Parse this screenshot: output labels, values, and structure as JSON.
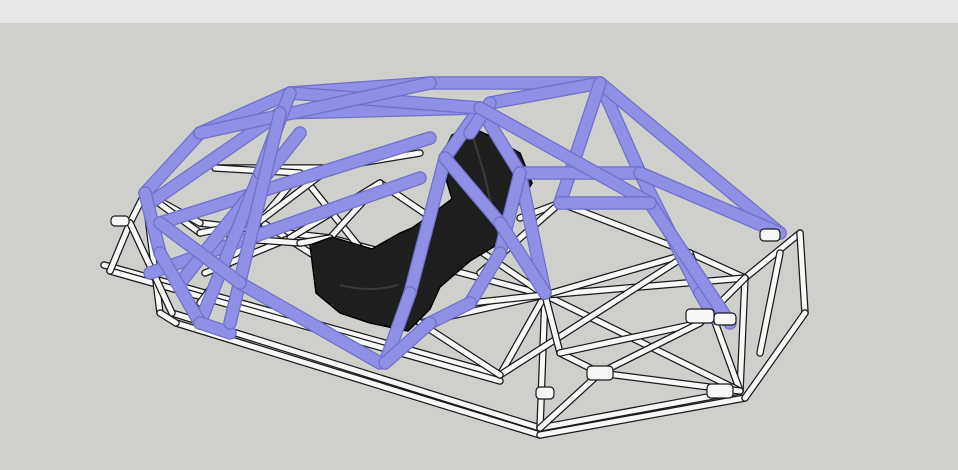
{
  "toolbar": {},
  "viewport": {
    "model": "tube-chassis-with-roll-cage",
    "colors": {
      "background": "#cfd0cc",
      "rollCage": "#8f90e6",
      "rollCageShade": "#6f70c8",
      "frame": "#f7f7f7",
      "frameEdge": "#1a1a1a",
      "seat": "#1e1e1e"
    }
  }
}
